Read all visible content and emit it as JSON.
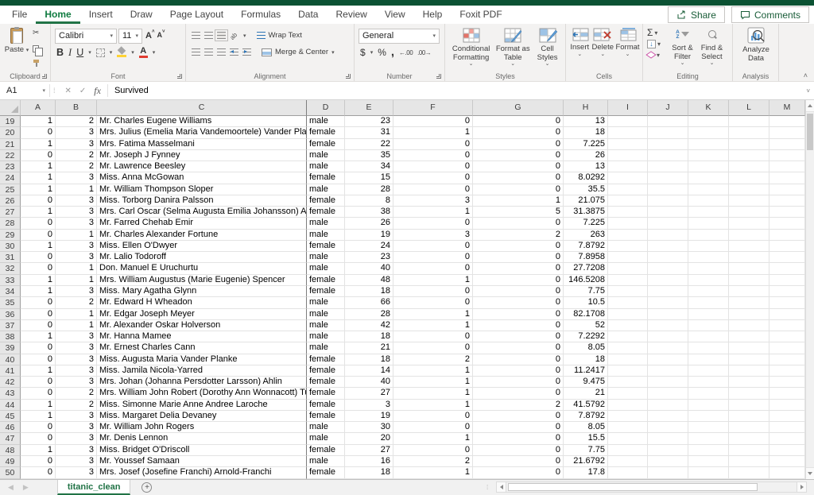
{
  "menubar": {
    "tabs": [
      "File",
      "Home",
      "Insert",
      "Draw",
      "Page Layout",
      "Formulas",
      "Data",
      "Review",
      "View",
      "Help",
      "Foxit PDF"
    ],
    "active_tab": "Home",
    "share_label": "Share",
    "comments_label": "Comments"
  },
  "ribbon": {
    "clipboard": {
      "group_label": "Clipboard",
      "paste_label": "Paste"
    },
    "font": {
      "group_label": "Font",
      "font_name": "Calibri",
      "font_size": "11",
      "bold": "B",
      "italic": "I",
      "underline": "U",
      "grow_letter": "A",
      "shrink_letter": "A",
      "font_color_letter": "A"
    },
    "alignment": {
      "group_label": "Alignment",
      "orientation_label": "ab",
      "wrap_text_label": "Wrap Text",
      "merge_center_label": "Merge & Center"
    },
    "number": {
      "group_label": "Number",
      "format_value": "General",
      "currency": "$",
      "percent": "%",
      "comma": ",",
      "increase_decimal": "←.00",
      "decrease_decimal": ".00→"
    },
    "styles": {
      "group_label": "Styles",
      "conditional_formatting_label": "Conditional Formatting",
      "format_as_table_label": "Format as Table",
      "cell_styles_label": "Cell Styles"
    },
    "cells": {
      "group_label": "Cells",
      "insert_label": "Insert",
      "delete_label": "Delete",
      "format_label": "Format"
    },
    "editing": {
      "group_label": "Editing",
      "autosum": "Σ",
      "sort_a": "A",
      "sort_z": "Z",
      "sort_filter_label": "Sort & Filter",
      "find_select_label": "Find & Select"
    },
    "analysis": {
      "group_label": "Analysis",
      "analyze_data_label": "Analyze Data"
    }
  },
  "formula_bar": {
    "name_box": "A1",
    "fx": "fx",
    "content": "Survived"
  },
  "grid": {
    "columns": [
      "A",
      "B",
      "C",
      "D",
      "E",
      "F",
      "G",
      "H",
      "I",
      "J",
      "K",
      "L",
      "M"
    ],
    "rows": [
      {
        "n": "19",
        "cells": [
          "1",
          "2",
          "Mr. Charles Eugene Williams",
          "male",
          "23",
          "0",
          "0",
          "13"
        ]
      },
      {
        "n": "20",
        "cells": [
          "0",
          "3",
          "Mrs. Julius (Emelia Maria Vandemoortele) Vander Planke",
          "female",
          "31",
          "1",
          "0",
          "18"
        ]
      },
      {
        "n": "21",
        "cells": [
          "1",
          "3",
          "Mrs. Fatima Masselmani",
          "female",
          "22",
          "0",
          "0",
          "7.225"
        ]
      },
      {
        "n": "22",
        "cells": [
          "0",
          "2",
          "Mr. Joseph J Fynney",
          "male",
          "35",
          "0",
          "0",
          "26"
        ]
      },
      {
        "n": "23",
        "cells": [
          "1",
          "2",
          "Mr. Lawrence Beesley",
          "male",
          "34",
          "0",
          "0",
          "13"
        ]
      },
      {
        "n": "24",
        "cells": [
          "1",
          "3",
          "Miss. Anna McGowan",
          "female",
          "15",
          "0",
          "0",
          "8.0292"
        ]
      },
      {
        "n": "25",
        "cells": [
          "1",
          "1",
          "Mr. William Thompson Sloper",
          "male",
          "28",
          "0",
          "0",
          "35.5"
        ]
      },
      {
        "n": "26",
        "cells": [
          "0",
          "3",
          "Miss. Torborg Danira Palsson",
          "female",
          "8",
          "3",
          "1",
          "21.075"
        ]
      },
      {
        "n": "27",
        "cells": [
          "1",
          "3",
          "Mrs. Carl Oscar (Selma Augusta Emilia Johansson) Asplund",
          "female",
          "38",
          "1",
          "5",
          "31.3875"
        ]
      },
      {
        "n": "28",
        "cells": [
          "0",
          "3",
          "Mr. Farred Chehab Emir",
          "male",
          "26",
          "0",
          "0",
          "7.225"
        ]
      },
      {
        "n": "29",
        "cells": [
          "0",
          "1",
          "Mr. Charles Alexander Fortune",
          "male",
          "19",
          "3",
          "2",
          "263"
        ]
      },
      {
        "n": "30",
        "cells": [
          "1",
          "3",
          "Miss. Ellen O'Dwyer",
          "female",
          "24",
          "0",
          "0",
          "7.8792"
        ]
      },
      {
        "n": "31",
        "cells": [
          "0",
          "3",
          "Mr. Lalio Todoroff",
          "male",
          "23",
          "0",
          "0",
          "7.8958"
        ]
      },
      {
        "n": "32",
        "cells": [
          "0",
          "1",
          "Don. Manuel E Uruchurtu",
          "male",
          "40",
          "0",
          "0",
          "27.7208"
        ]
      },
      {
        "n": "33",
        "cells": [
          "1",
          "1",
          "Mrs. William Augustus (Marie Eugenie) Spencer",
          "female",
          "48",
          "1",
          "0",
          "146.5208"
        ]
      },
      {
        "n": "34",
        "cells": [
          "1",
          "3",
          "Miss. Mary Agatha Glynn",
          "female",
          "18",
          "0",
          "0",
          "7.75"
        ]
      },
      {
        "n": "35",
        "cells": [
          "0",
          "2",
          "Mr. Edward H Wheadon",
          "male",
          "66",
          "0",
          "0",
          "10.5"
        ]
      },
      {
        "n": "36",
        "cells": [
          "0",
          "1",
          "Mr. Edgar Joseph Meyer",
          "male",
          "28",
          "1",
          "0",
          "82.1708"
        ]
      },
      {
        "n": "37",
        "cells": [
          "0",
          "1",
          "Mr. Alexander Oskar Holverson",
          "male",
          "42",
          "1",
          "0",
          "52"
        ]
      },
      {
        "n": "38",
        "cells": [
          "1",
          "3",
          "Mr. Hanna Mamee",
          "male",
          "18",
          "0",
          "0",
          "7.2292"
        ]
      },
      {
        "n": "39",
        "cells": [
          "0",
          "3",
          "Mr. Ernest Charles Cann",
          "male",
          "21",
          "0",
          "0",
          "8.05"
        ]
      },
      {
        "n": "40",
        "cells": [
          "0",
          "3",
          "Miss. Augusta Maria Vander Planke",
          "female",
          "18",
          "2",
          "0",
          "18"
        ]
      },
      {
        "n": "41",
        "cells": [
          "1",
          "3",
          "Miss. Jamila Nicola-Yarred",
          "female",
          "14",
          "1",
          "0",
          "11.2417"
        ]
      },
      {
        "n": "42",
        "cells": [
          "0",
          "3",
          "Mrs. Johan (Johanna Persdotter Larsson) Ahlin",
          "female",
          "40",
          "1",
          "0",
          "9.475"
        ]
      },
      {
        "n": "43",
        "cells": [
          "0",
          "2",
          "Mrs. William John Robert (Dorothy Ann Wonnacott) Turpin",
          "female",
          "27",
          "1",
          "0",
          "21"
        ]
      },
      {
        "n": "44",
        "cells": [
          "1",
          "2",
          "Miss. Simonne Marie Anne Andree Laroche",
          "female",
          "3",
          "1",
          "2",
          "41.5792"
        ]
      },
      {
        "n": "45",
        "cells": [
          "1",
          "3",
          "Miss. Margaret Delia Devaney",
          "female",
          "19",
          "0",
          "0",
          "7.8792"
        ]
      },
      {
        "n": "46",
        "cells": [
          "0",
          "3",
          "Mr. William John Rogers",
          "male",
          "30",
          "0",
          "0",
          "8.05"
        ]
      },
      {
        "n": "47",
        "cells": [
          "0",
          "3",
          "Mr. Denis Lennon",
          "male",
          "20",
          "1",
          "0",
          "15.5"
        ]
      },
      {
        "n": "48",
        "cells": [
          "1",
          "3",
          "Miss. Bridget O'Driscoll",
          "female",
          "27",
          "0",
          "0",
          "7.75"
        ]
      },
      {
        "n": "49",
        "cells": [
          "0",
          "3",
          "Mr. Youssef Samaan",
          "male",
          "16",
          "2",
          "0",
          "21.6792"
        ]
      },
      {
        "n": "50",
        "cells": [
          "0",
          "3",
          "Mrs. Josef (Josefine Franchi) Arnold-Franchi",
          "female",
          "18",
          "1",
          "0",
          "17.8"
        ]
      }
    ]
  },
  "sheet_bar": {
    "tab_name": "titanic_clean"
  }
}
